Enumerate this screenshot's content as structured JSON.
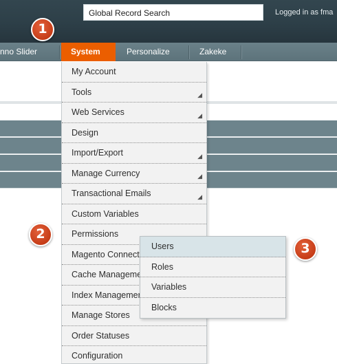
{
  "header": {
    "search_value": "Global Record Search",
    "logged_in_text": "Logged in as fma"
  },
  "nav": {
    "items": [
      {
        "label": "nno Slider"
      },
      {
        "label": "System"
      },
      {
        "label": "Personalize"
      },
      {
        "label": "Zakeke"
      }
    ],
    "active_color": "#eb5e00"
  },
  "system_menu": {
    "items": [
      {
        "label": "My Account"
      },
      {
        "label": "Tools"
      },
      {
        "label": "Web Services"
      },
      {
        "label": "Design"
      },
      {
        "label": "Import/Export"
      },
      {
        "label": "Manage Currency"
      },
      {
        "label": "Transactional Emails"
      },
      {
        "label": "Custom Variables"
      },
      {
        "label": "Permissions"
      },
      {
        "label": "Magento Connect"
      },
      {
        "label": "Cache Management"
      },
      {
        "label": "Index Management"
      },
      {
        "label": "Manage Stores"
      },
      {
        "label": "Order Statuses"
      },
      {
        "label": "Configuration"
      }
    ]
  },
  "permissions_submenu": {
    "items": [
      {
        "label": "Users"
      },
      {
        "label": "Roles"
      },
      {
        "label": "Variables"
      },
      {
        "label": "Blocks"
      }
    ]
  },
  "callouts": {
    "one": "1",
    "two": "2",
    "three": "3",
    "color": "#c63d18"
  }
}
